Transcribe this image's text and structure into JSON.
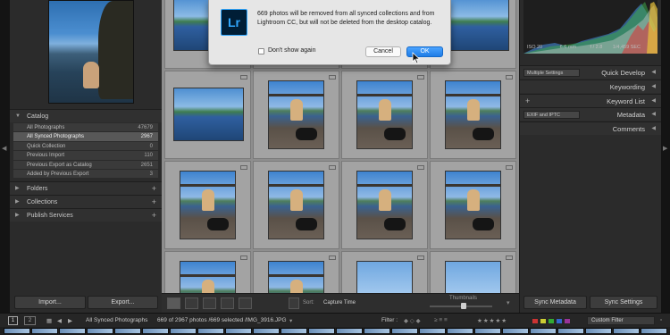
{
  "left_panel": {
    "catalog": {
      "title": "Catalog",
      "items": [
        {
          "name": "All Photographs",
          "count": "47679"
        },
        {
          "name": "All Synced Photographs",
          "count": "2967",
          "selected": true
        },
        {
          "name": "Quick Collection",
          "count": "0"
        },
        {
          "name": "Previous Import",
          "count": "110"
        },
        {
          "name": "Previous Export as Catalog",
          "count": "2651"
        },
        {
          "name": "Added by Previous Export",
          "count": "3"
        }
      ]
    },
    "folders_label": "Folders",
    "collections_label": "Collections",
    "publish_label": "Publish Services",
    "import_label": "Import...",
    "export_label": "Export..."
  },
  "dialog": {
    "icon_text": "Lr",
    "message": "669 photos will be removed from all synced collections and from Lightroom CC, but will not be deleted from the desktop catalog.",
    "checkbox_label": "Don't show again",
    "cancel_label": "Cancel",
    "ok_label": "OK"
  },
  "toolbar": {
    "sort_label": "Sort:",
    "sort_value": "Capture Time",
    "thumbnails_label": "Thumbnails"
  },
  "right_panel": {
    "histogram_stats": {
      "iso": "ISO 20",
      "focal": "6.6 mm",
      "aperture": "f / 2.8",
      "shutter": "1/4,459 SEC"
    },
    "quick_develop": {
      "preset": "Multiple Settings",
      "label": "Quick Develop"
    },
    "keywording_label": "Keywording",
    "keyword_list_label": "Keyword List",
    "metadata": {
      "preset": "EXIF and IPTC",
      "label": "Metadata"
    },
    "comments_label": "Comments",
    "sync_metadata_label": "Sync Metadata",
    "sync_settings_label": "Sync Settings"
  },
  "filmstrip": {
    "page_1": "1",
    "page_2": "2",
    "source": "All Synced Photographs",
    "selection": "669 of 2967 photos /669 selected /IMG_3916.JPG",
    "filter_label": "Filter :",
    "custom_filter": "Custom Filter"
  },
  "colors": {
    "dialog_ok": "#1f7de6",
    "lr_blue": "#31a8ff",
    "panel_bg": "#2b2b2b",
    "grid_bg": "#8e8e8e"
  },
  "grid_cells": [
    {
      "type": "landscape"
    },
    {
      "type": "portrait"
    },
    {
      "type": "portrait"
    },
    {
      "type": "portrait"
    },
    {
      "type": "portrait"
    },
    {
      "type": "portrait"
    },
    {
      "type": "portrait"
    },
    {
      "type": "portrait"
    },
    {
      "type": "portrait"
    },
    {
      "type": "portrait"
    },
    {
      "type": "sky"
    },
    {
      "type": "sky"
    }
  ]
}
